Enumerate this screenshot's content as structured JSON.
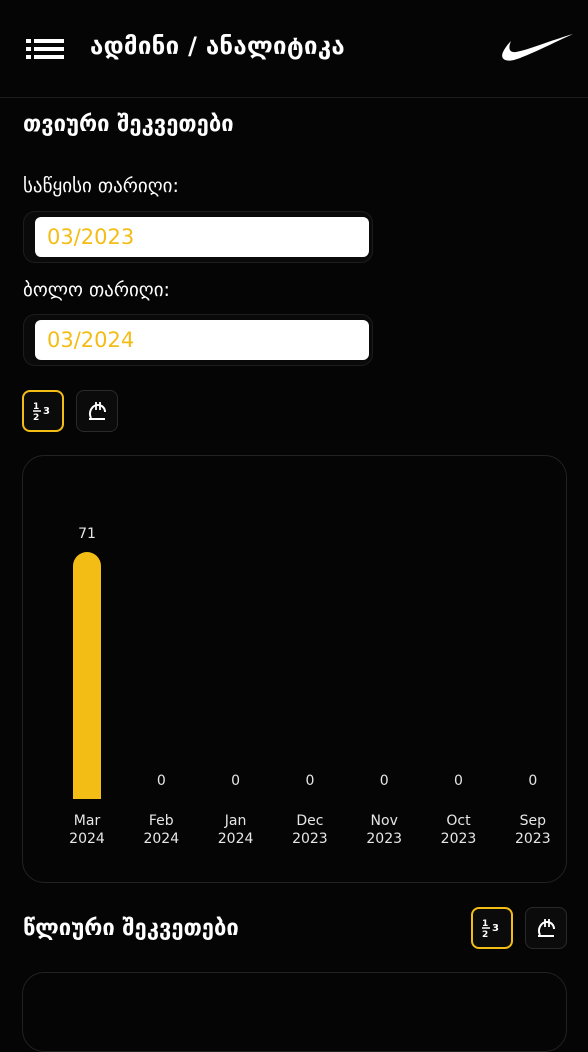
{
  "header": {
    "title": "ადმინი / ანალიტიკა"
  },
  "monthly": {
    "title": "თვიური შეკვეთები",
    "start_label": "საწყისი თარიღი:",
    "start_value": "03/2023",
    "end_label": "ბოლო თარიღი:",
    "end_value": "03/2024",
    "toggle_count_label": "½3",
    "toggle_currency_label": "₾"
  },
  "yearly": {
    "title": "წლიური შეკვეთები"
  },
  "colors": {
    "accent": "#f4bd16",
    "background": "#050505",
    "card_border": "#222222"
  },
  "chart_data": {
    "type": "bar",
    "categories": [
      [
        "Mar",
        "2024"
      ],
      [
        "Feb",
        "2024"
      ],
      [
        "Jan",
        "2024"
      ],
      [
        "Dec",
        "2023"
      ],
      [
        "Nov",
        "2023"
      ],
      [
        "Oct",
        "2023"
      ],
      [
        "Sep",
        "2023"
      ]
    ],
    "values": [
      71,
      0,
      0,
      0,
      0,
      0,
      0
    ],
    "ylim": [
      0,
      71
    ],
    "grid": false,
    "bar_color": "#f4bd16"
  }
}
